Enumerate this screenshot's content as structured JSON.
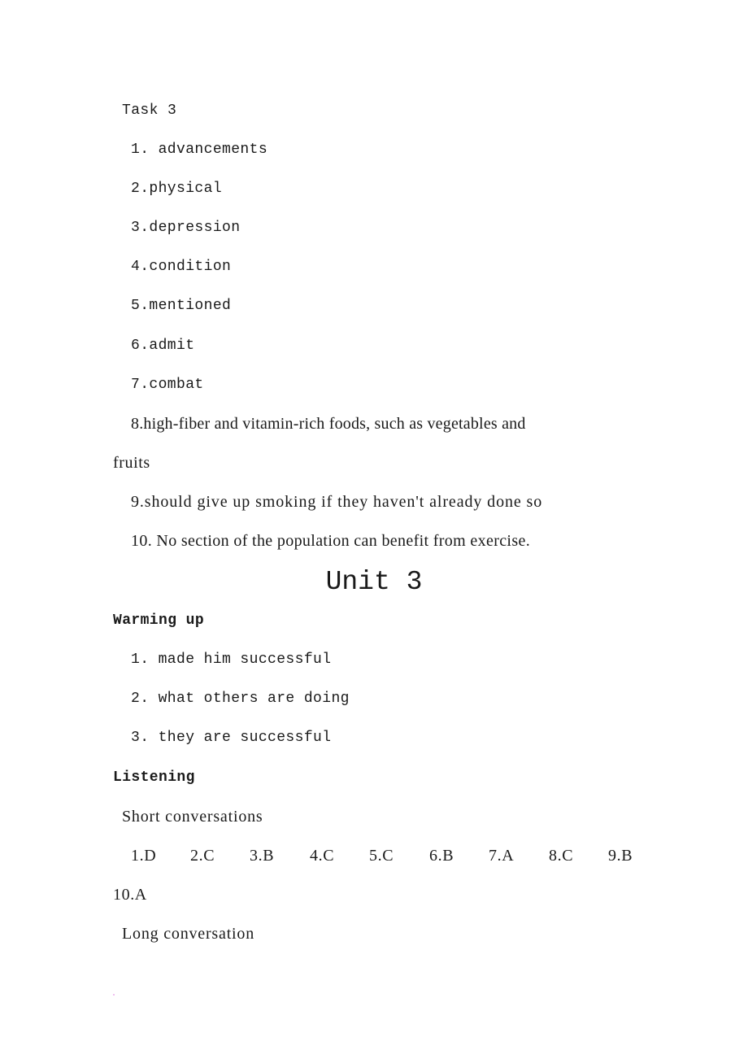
{
  "task3": {
    "heading": "Task 3",
    "items": [
      "1. advancements",
      "2.physical",
      "3.depression",
      "4.condition",
      "5.mentioned",
      "6.admit",
      "7.combat",
      "8.high-fiber and vitamin-rich foods, such as vegetables and",
      "fruits",
      "9.should give up smoking if they haven't already done so",
      "10. No section of the population can benefit from exercise."
    ]
  },
  "unit": {
    "title": "Unit 3"
  },
  "warming_up": {
    "heading": "Warming up",
    "items": [
      "1. made him successful",
      "2. what others are doing",
      "3. they are successful"
    ]
  },
  "listening": {
    "heading": "Listening",
    "short_conversations": {
      "heading": "Short conversations",
      "answers": [
        "1.D",
        "2.C",
        "3.B",
        "4.C",
        "5.C",
        "6.B",
        "7.A",
        "8.C",
        "9.B",
        "10.A"
      ]
    },
    "long_conversation": {
      "heading": "Long conversation"
    }
  }
}
